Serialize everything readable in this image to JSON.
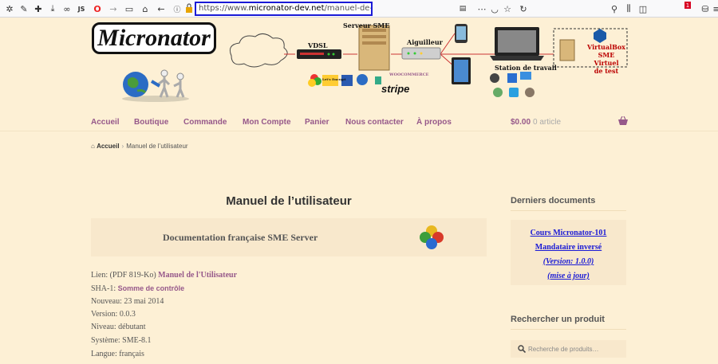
{
  "browser": {
    "url_prefix": "https://www.",
    "url_domain": "micronator-dev.net",
    "url_path": "/manuel-de-lutilisateur/",
    "js_label": "JS",
    "notif_count": "1"
  },
  "header": {
    "logo_text": "Micronator",
    "diagram": {
      "vdsl": "VDSL",
      "server": "Serveur SME",
      "switch": "Aiguilleur",
      "station": "Station de travail",
      "vbox": [
        "VirtualBox",
        "SME Virtuel",
        "de test"
      ],
      "stripe": "stripe",
      "woo": "WOOCOMMERCE",
      "le": "Let's Encrypt"
    }
  },
  "nav": {
    "items": [
      "Accueil",
      "Boutique",
      "Commande",
      "Mon Compte",
      "Panier",
      "Nous contacter",
      "À propos"
    ],
    "cart_amount": "$0.00",
    "cart_count": "0 article"
  },
  "breadcrumb": {
    "home": "Accueil",
    "current": "Manuel de l’utilisateur"
  },
  "main": {
    "title": "Manuel de l’utilisateur",
    "doc_box_title": "Documentation française SME Server",
    "link_prefix": "Lien: (PDF 819-Ko)",
    "link_text": "Manuel de l'Utilisateur",
    "sha_prefix": "SHA-1:",
    "sha_link": "Somme de contrôle",
    "new_line": "Nouveau: 23 mai 2014",
    "version_line": "Version: 0.0.3",
    "level_line": "Niveau: débutant",
    "system_line": "Système: SME-8.1",
    "lang_line": "Langue: français"
  },
  "sidebar": {
    "docs_heading": "Derniers documents",
    "doc_links": [
      "Cours Micronator-101",
      "Mandataire inversé",
      "(Version: 1.0.0)",
      "(mise à jour)"
    ],
    "search_heading": "Rechercher un produit",
    "search_placeholder": "Recherche de produits…"
  },
  "colors": {
    "accent": "#96588a",
    "background": "#fdf0d5",
    "link_blue": "#1a1ad6"
  }
}
